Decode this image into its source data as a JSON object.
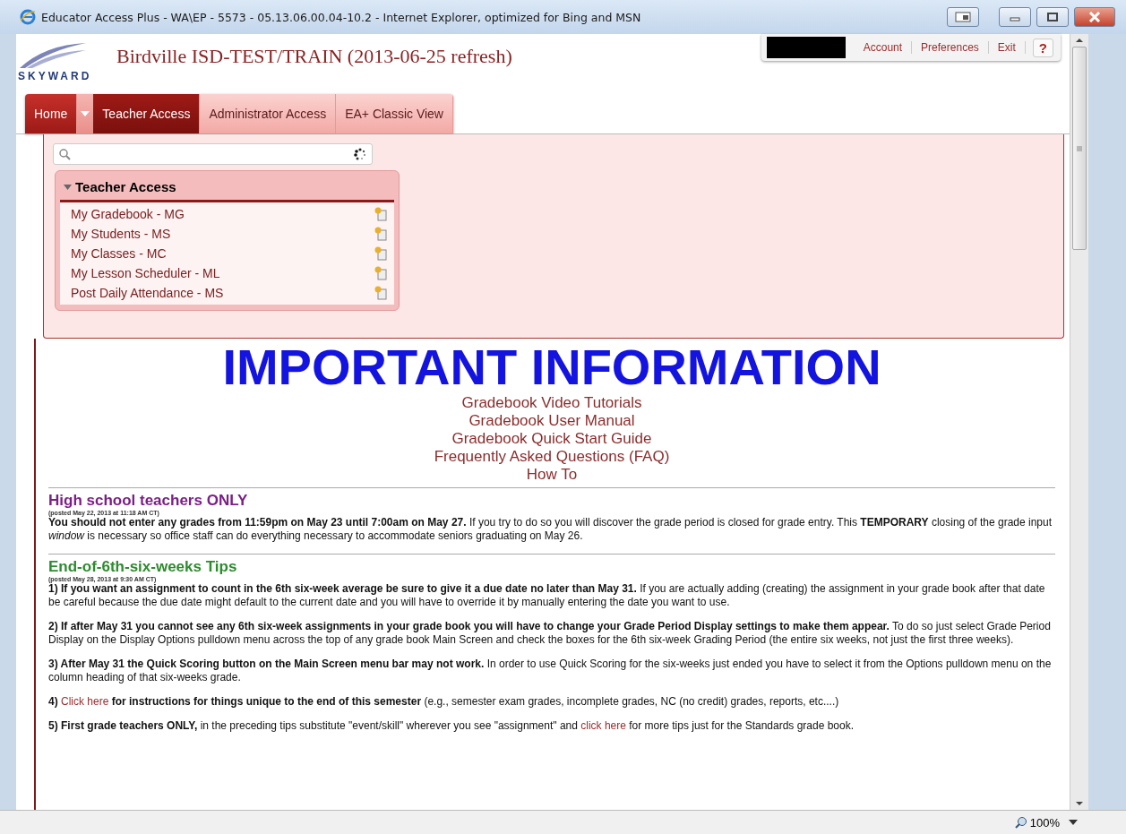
{
  "window": {
    "title": "Educator Access Plus - WA\\EP - 5573 - 05.13.06.00.04-10.2 - Internet Explorer, optimized for Bing and MSN"
  },
  "header": {
    "logo": "SKYWARD",
    "site_title": "Birdville ISD-TEST/TRAIN (2013-06-25 refresh)",
    "user_links": [
      "Account",
      "Preferences",
      "Exit"
    ],
    "help": "?"
  },
  "nav_tabs": [
    {
      "label": "Home",
      "kind": "home",
      "selected": false
    },
    {
      "label": "Teacher Access",
      "kind": "tab",
      "selected": true
    },
    {
      "label": "Administrator Access",
      "kind": "tab",
      "selected": false
    },
    {
      "label": "EA+ Classic View",
      "kind": "tab",
      "selected": false
    }
  ],
  "dropdown": {
    "group": {
      "title": "Teacher Access",
      "expanded": true,
      "items": [
        "My Gradebook - MG",
        "My Students - MS",
        "My Classes - MC",
        "My Lesson Scheduler - ML",
        "Post Daily Attendance - MS"
      ]
    }
  },
  "important": {
    "heading": "IMPORTANT INFORMATION",
    "links": [
      "Gradebook Video Tutorials",
      "Gradebook User Manual",
      "Gradebook Quick Start Guide",
      "Frequently Asked Questions (FAQ)",
      "How To"
    ]
  },
  "sections": [
    {
      "title": "High school teachers ONLY",
      "color": "#7b1f86",
      "posted": "(posted May 22, 2013 at 11:18 AM CT)",
      "paragraphs": [
        [
          {
            "kind": "b",
            "text": "You should not enter any grades from 11:59pm on May 23 until 7:00am on May 27."
          },
          {
            "kind": "p",
            "text": " If you try to do so you will discover the grade period is closed for grade entry. This "
          },
          {
            "kind": "b",
            "text": "TEMPORARY"
          },
          {
            "kind": "p",
            "text": " closing of the grade input "
          },
          {
            "kind": "i",
            "text": "window"
          },
          {
            "kind": "p",
            "text": " is necessary so office staff can do everything necessary to accommodate seniors graduating on May 26."
          }
        ]
      ]
    },
    {
      "title": "End-of-6th-six-weeks Tips",
      "color": "#2e8b2e",
      "posted": "(posted May 28, 2013 at 9:30 AM CT)",
      "paragraphs": [
        [
          {
            "kind": "b",
            "text": "1) If you want an assignment to count in the 6th six-week average be sure to give it a due date no later than May 31."
          },
          {
            "kind": "p",
            "text": " If you are actually adding (creating) the assignment in your grade book after that date be careful because the due date might default to the current date and you will have to override it by manually entering the date you want to use."
          }
        ],
        [
          {
            "kind": "b",
            "text": "2) If after May 31 you cannot see any 6th six-week assignments in your grade book you will have to change your Grade Period Display settings to make them appear."
          },
          {
            "kind": "p",
            "text": " To do so just select Grade Period Display on the Display Options pulldown menu across the top of any grade book Main Screen and check the boxes for the 6th six-week Grading Period (the entire six weeks, not just the first three weeks)."
          }
        ],
        [
          {
            "kind": "b",
            "text": "3) After May 31 the Quick Scoring button on the Main Screen menu bar may not work."
          },
          {
            "kind": "p",
            "text": " In order to use Quick Scoring for the six-weeks just ended you have to select it from the Options pulldown menu on the column heading of that six-weeks grade."
          }
        ],
        [
          {
            "kind": "b",
            "text": "4) "
          },
          {
            "kind": "a",
            "text": "Click here"
          },
          {
            "kind": "b",
            "text": " for instructions for things unique to the end of this semester"
          },
          {
            "kind": "p",
            "text": " (e.g., semester exam grades, incomplete grades, NC (no credit) grades, reports, etc....)"
          }
        ],
        [
          {
            "kind": "b",
            "text": "5) First grade teachers ONLY,"
          },
          {
            "kind": "p",
            "text": " in the preceding tips substitute \"event/skill\" wherever you see \"assignment\" and "
          },
          {
            "kind": "a",
            "text": "click here"
          },
          {
            "kind": "p",
            "text": " for more tips just for the Standards grade book."
          }
        ]
      ]
    }
  ],
  "status_bar": {
    "zoom": "100%"
  }
}
